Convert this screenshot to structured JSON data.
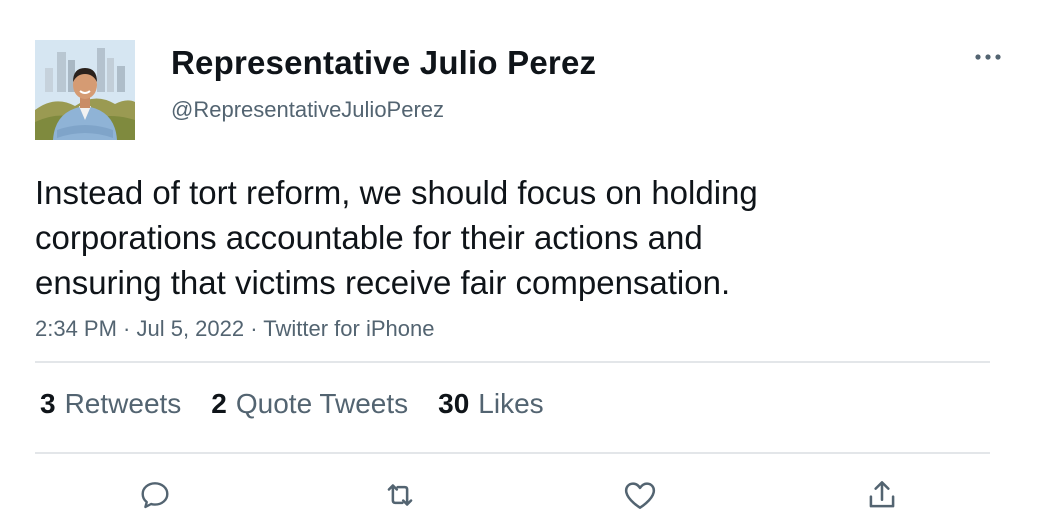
{
  "author": {
    "display_name": "Representative Julio Perez",
    "handle": "@RepresentativeJulioPerez",
    "avatar_icon": "profile-photo"
  },
  "tweet": {
    "text_lines": [
      "Instead of tort reform, we should focus on holding",
      "corporations accountable for their actions and",
      "ensuring that victims receive fair compensation."
    ],
    "meta": "2:34 PM · Jul 5, 2022 · Twitter for iPhone"
  },
  "stats": {
    "retweets": {
      "count": "3",
      "label": "Retweets"
    },
    "quotes": {
      "count": "2",
      "label": "Quote Tweets"
    },
    "likes": {
      "count": "30",
      "label": "Likes"
    }
  },
  "actions": {
    "reply_icon": "reply-icon",
    "retweet_icon": "retweet-icon",
    "like_icon": "heart-icon",
    "share_icon": "share-icon",
    "more_icon": "more-options-icon"
  },
  "colors": {
    "text": "#0f1419",
    "secondary": "#536471",
    "divider": "#e3e6e9"
  }
}
